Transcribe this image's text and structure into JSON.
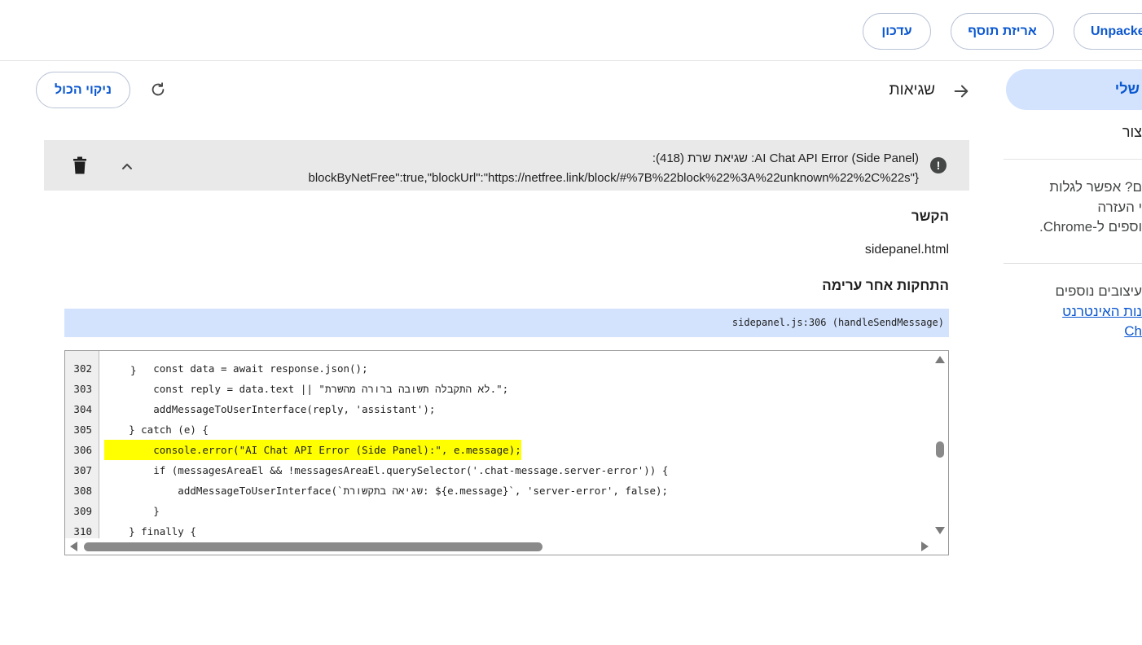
{
  "toolbar": {
    "unpacked_label": "Unpacke",
    "pack_label": "אריזת תוסף",
    "update_label": "עדכון"
  },
  "errors_header": {
    "title": "שגיאות",
    "clear_all_label": "ניקוי הכול"
  },
  "error": {
    "message_line1": "AI Chat API Error (Side Panel): שגיאת שרת (418):",
    "message_line2": "blockByNetFree\":true,\"blockUrl\":\"https://netfree.link/block/#%7B%22block%22%3A%22unknown%22%2C%22s\"}"
  },
  "details": {
    "context_label": "הקשר",
    "context_value": "sidepanel.html",
    "stack_label": "התחקות אחר ערימה",
    "stack_frame": "sidepanel.js:306 (handleSendMessage)"
  },
  "code": {
    "partial_top_line": "}",
    "lines": [
      {
        "num": "302",
        "text": "        const data = await response.json();",
        "highlight": false
      },
      {
        "num": "303",
        "text": "        const reply = data.text || \"לא התקבלה תשובה ברורה מהשרת.\";",
        "highlight": false
      },
      {
        "num": "304",
        "text": "        addMessageToUserInterface(reply, 'assistant');",
        "highlight": false
      },
      {
        "num": "305",
        "text": "    } catch (e) {",
        "highlight": false
      },
      {
        "num": "306",
        "text": "        console.error(\"AI Chat API Error (Side Panel):\", e.message);",
        "highlight": true
      },
      {
        "num": "307",
        "text": "        if (messagesAreaEl && !messagesAreaEl.querySelector('.chat-message.server-error')) {",
        "highlight": false
      },
      {
        "num": "308",
        "text": "            addMessageToUserInterface(`שגיאה בתקשורת: ${e.message}`, 'server-error', false);",
        "highlight": false
      },
      {
        "num": "309",
        "text": "        }",
        "highlight": false
      },
      {
        "num": "310",
        "text": "    } finally {",
        "highlight": false
      }
    ]
  },
  "sidebar": {
    "my_extensions_label": "שלי",
    "item_label": "צור",
    "help_line1": "ם? אפשר לגלות",
    "help_line2": "י העזרה",
    "help_line3": "וספים ל-Chrome.",
    "more_line1": "עיצובים נוספים",
    "more_link1": "נות האינטרנט",
    "more_link2": "Ch"
  },
  "colors": {
    "accent": "#0b57d0",
    "highlight": "#ffff00",
    "stack_bar": "#d3e3fd",
    "error_row": "#e9e9e9"
  }
}
